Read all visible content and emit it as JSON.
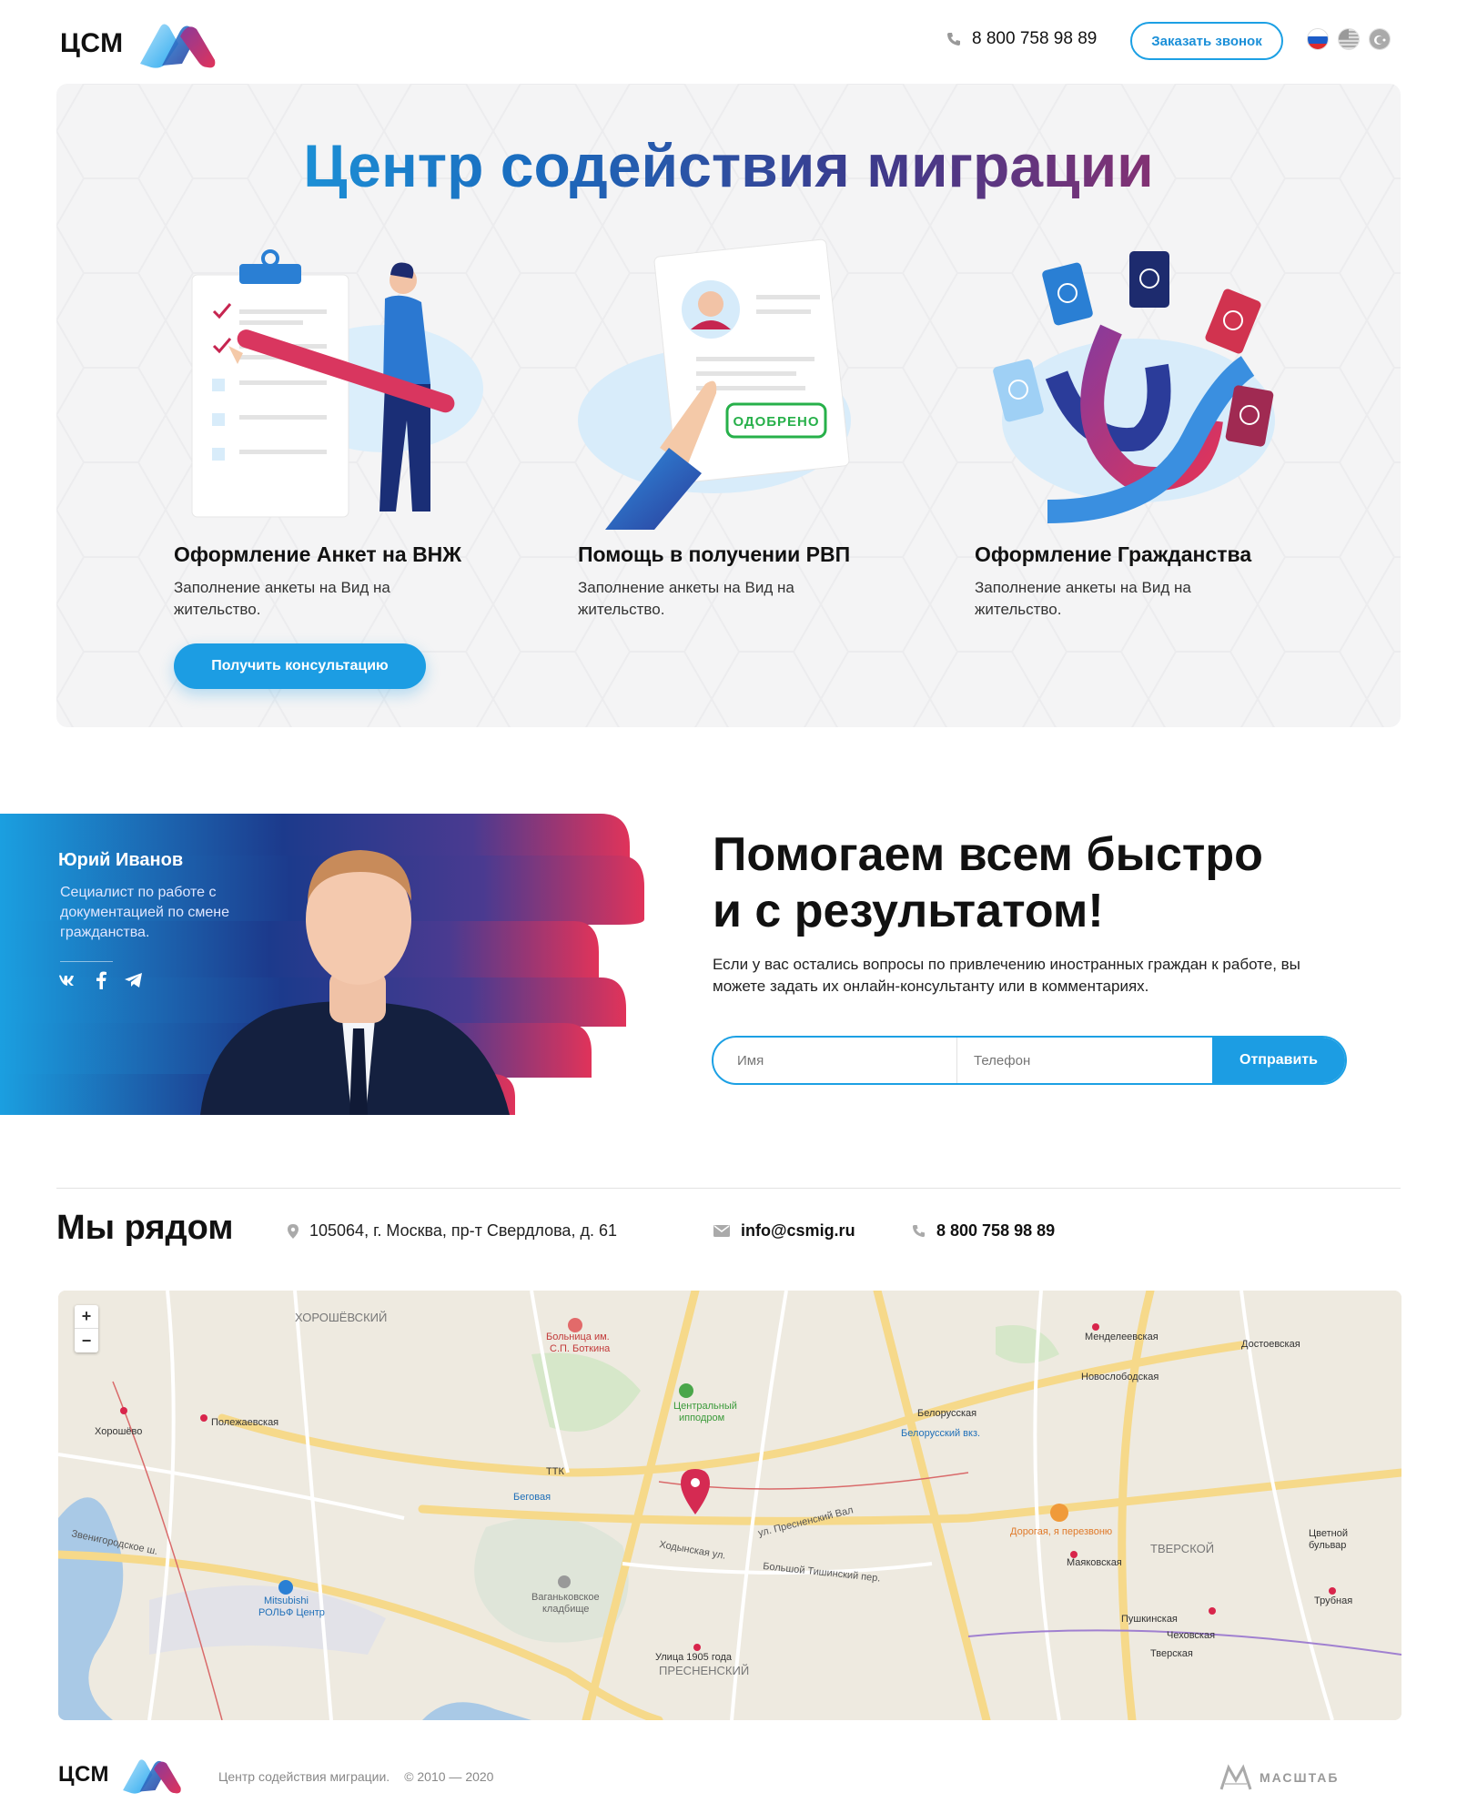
{
  "header": {
    "logo_text": "ЦСМ",
    "phone": "8 800 758 98 89",
    "callback_label": "Заказать звонок",
    "langs": [
      "ru-flag-icon",
      "us-flag-icon",
      "tr-flag-icon"
    ]
  },
  "hero": {
    "title": "Центр содействия миграции",
    "services": [
      {
        "title": "Оформление Анкет на ВНЖ",
        "text": "Заполнение анкеты на Вид на жительство.",
        "icon": "clipboard-man-illustration"
      },
      {
        "title": "Помощь в получении РВП",
        "text": "Заполнение анкеты на Вид на жительство.",
        "icon": "approved-document-illustration",
        "stamp": "ОДОБРЕНО"
      },
      {
        "title": "Оформление Гражданства",
        "text": "Заполнение анкеты на Вид на жительство.",
        "icon": "passports-hands-illustration"
      }
    ],
    "consult_label": "Получить консультацию"
  },
  "consultant": {
    "name": "Юрий Иванов",
    "role": "Сециалист по работе с документацией по смене гражданства.",
    "socials": [
      "vk-icon",
      "facebook-icon",
      "telegram-icon"
    ]
  },
  "pitch": {
    "title_line1": "Помогаем всем быстро",
    "title_line2": "и с результатом!",
    "text": "Если у вас остались вопросы по привлечению иностранных граждан к работе, вы можете задать их онлайн-консультанту или в комментариях.",
    "name_placeholder": "Имя",
    "phone_placeholder": "Телефон",
    "send_label": "Отправить"
  },
  "contacts": {
    "title": "Мы рядом",
    "address": "105064, г. Москва, пр-т Свердлова, д. 61",
    "email": "info@csmig.ru",
    "phone": "8 800 758 98 89"
  },
  "map": {
    "labels": [
      "ХОРОШЁВСКИЙ",
      "Полежаевская",
      "Хорошёво",
      "Беговая",
      "Центральный ипподром",
      "Белорусская",
      "Белорусский вкз.",
      "Менделеевская",
      "Новослободская",
      "Достоевская",
      "Маяковская",
      "ТВЕРСКОЙ",
      "Пушкинская",
      "Чеховская",
      "Тверская",
      "Трубная",
      "Цветной бульвар",
      "ПРЕСНЕНСКИЙ",
      "Улица 1905 года",
      "Ваганьковское кладбище",
      "Больница им. С.П. Боткина",
      "Mitsubishi РОЛЬФ Центр",
      "Дорогая, я перезвоню",
      "Звенигородское ш.",
      "Ходынская ул.",
      "ул. Пресненский Вал",
      "Большой Тишинский пер.",
      "ТТК"
    ],
    "zoom_in": "+",
    "zoom_out": "−"
  },
  "footer": {
    "logo_text": "ЦСМ",
    "company": "Центр содействия миграции.",
    "years": "© 2010 — 2020",
    "studio": "МАСШТАБ"
  }
}
